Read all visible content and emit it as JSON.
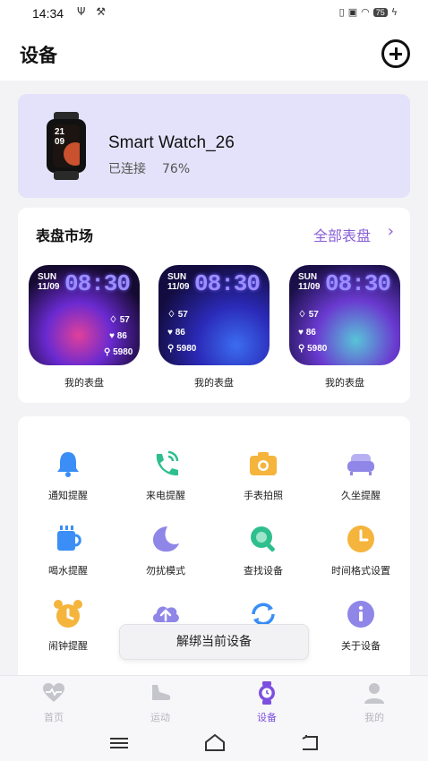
{
  "status_bar": {
    "time": "14:34",
    "left_icons": "Ψ ⚒",
    "battery": "75"
  },
  "header": {
    "title": "设备"
  },
  "device": {
    "name": "Smart Watch_26",
    "connection": "已连接",
    "battery": "76%",
    "watch_time": "21\n09"
  },
  "market": {
    "title": "表盘市场",
    "all_link": "全部表盘",
    "faces": [
      {
        "day": "SUN",
        "date": "11/09",
        "time": "08:30",
        "s1": "57",
        "s2": "86",
        "s3": "5980",
        "label": "我的表盘"
      },
      {
        "day": "SUN",
        "date": "11/09",
        "time": "08:30",
        "s1": "57",
        "s2": "86",
        "s3": "5980",
        "label": "我的表盘"
      },
      {
        "day": "SUN",
        "date": "11/09",
        "time": "08:30",
        "s1": "57",
        "s2": "86",
        "s3": "5980",
        "label": "我的表盘"
      }
    ]
  },
  "functions": [
    {
      "label": "通知提醒",
      "icon": "bell-icon",
      "color": "#3a8ef6"
    },
    {
      "label": "来电提醒",
      "icon": "phone-icon",
      "color": "#2fbf8f"
    },
    {
      "label": "手表拍照",
      "icon": "camera-icon",
      "color": "#f5b43c"
    },
    {
      "label": "久坐提醒",
      "icon": "sofa-icon",
      "color": "#8f86e8"
    },
    {
      "label": "喝水提醒",
      "icon": "cup-icon",
      "color": "#3a8ef6"
    },
    {
      "label": "勿扰模式",
      "icon": "moon-icon",
      "color": "#8f86e8"
    },
    {
      "label": "查找设备",
      "icon": "search-icon",
      "color": "#2fbf8f"
    },
    {
      "label": "时间格式设置",
      "icon": "clock-icon",
      "color": "#f5b43c"
    },
    {
      "label": "闹钟提醒",
      "icon": "alarm-icon",
      "color": "#f5b43c"
    },
    {
      "label": "",
      "icon": "upload-cloud-icon",
      "color": "#8f86e8"
    },
    {
      "label": "",
      "icon": "sync-icon",
      "color": "#3a8ef6"
    },
    {
      "label": "关于设备",
      "icon": "info-icon",
      "color": "#8f86e8"
    }
  ],
  "toast": {
    "text": "解绑当前设备"
  },
  "tabs": [
    {
      "label": "首页",
      "icon": "heart-pulse-icon"
    },
    {
      "label": "运动",
      "icon": "shoe-icon"
    },
    {
      "label": "设备",
      "icon": "watch-icon"
    },
    {
      "label": "我的",
      "icon": "user-icon"
    }
  ],
  "colors": {
    "accent": "#7d4fe0",
    "device_card_bg": "#e3e2fa",
    "link": "#8a5fd6"
  }
}
